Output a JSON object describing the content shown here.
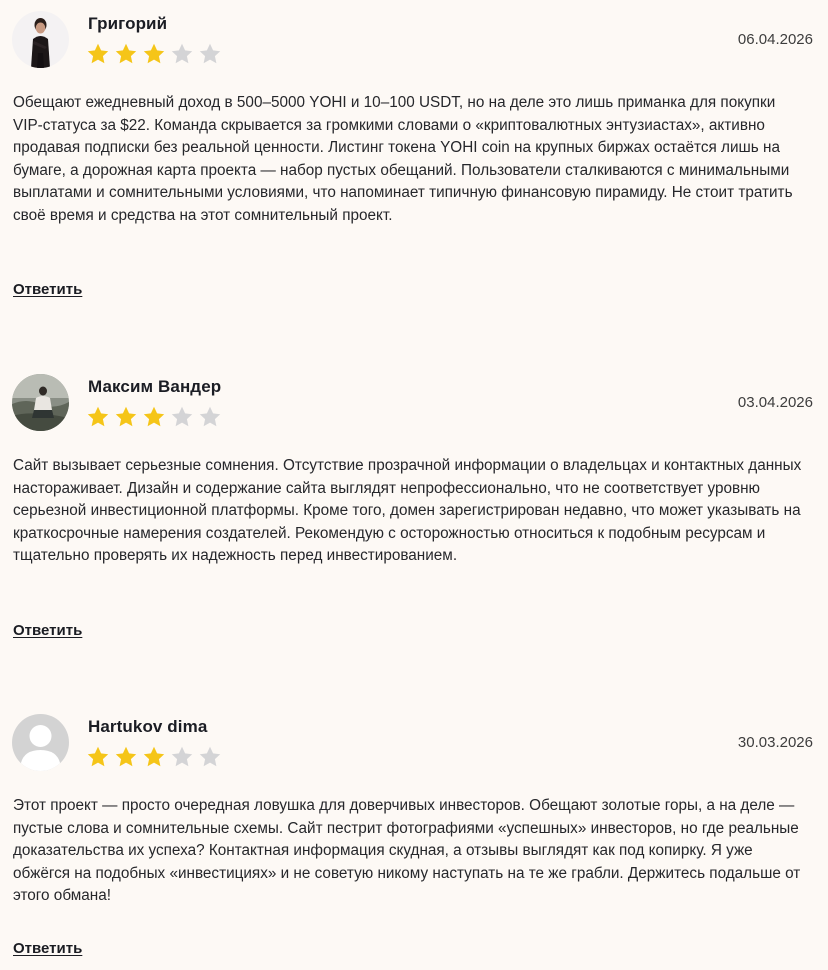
{
  "reviews": [
    {
      "author": "Григорий",
      "date": "06.04.2026",
      "rating": 3,
      "max_rating": 5,
      "text": "Обещают ежедневный доход в 500–5000 YOHI и 10–100 USDT, но на деле это лишь приманка для покупки VIP-статуса за $22. Команда скрывается за громкими словами о «криптовалютных энтузиастах», активно продавая подписки без реальной ценности. Листинг токена YOHI coin на крупных биржах остаётся лишь на бумаге, а дорожная карта проекта — набор пустых обещаний. Пользователи сталкиваются с минимальными выплатами и сомнительными условиями, что напоминает типичную финансовую пирамиду. Не стоит тратить своё время и средства на этот сомнительный проект.",
      "reply_label": "Ответить"
    },
    {
      "author": "Максим Вандер",
      "date": "03.04.2026",
      "rating": 3,
      "max_rating": 5,
      "text": "Сайт вызывает серьезные сомнения. Отсутствие прозрачной информации о владельцах и контактных данных настораживает. Дизайн и содержание сайта выглядят непрофессионально, что не соответствует уровню серьезной инвестиционной платформы. Кроме того, домен зарегистрирован недавно, что может указывать на краткосрочные намерения создателей. Рекомендую с осторожностью относиться к подобным ресурсам и тщательно проверять их надежность перед инвестированием.",
      "reply_label": "Ответить"
    },
    {
      "author": "Hartukov dima",
      "date": "30.03.2026",
      "rating": 3,
      "max_rating": 5,
      "text": "Этот проект — просто очередная ловушка для доверчивых инвесторов. Обещают золотые горы, а на деле — пустые слова и сомнительные схемы. Сайт пестрит фотографиями «успешных» инвесторов, но где реальные доказательства их успеха? Контактная информация скудная, а отзывы выглядят как под копирку. Я уже обжёгся на подобных «инвестициях» и не советую никому наступать на те же грабли. Держитесь подальше от этого обмана!",
      "reply_label": "Ответить"
    }
  ],
  "colors": {
    "background": "#fdf9f5",
    "star_filled": "#f5c518",
    "star_empty": "#d4d4d6",
    "text": "#26272b"
  }
}
